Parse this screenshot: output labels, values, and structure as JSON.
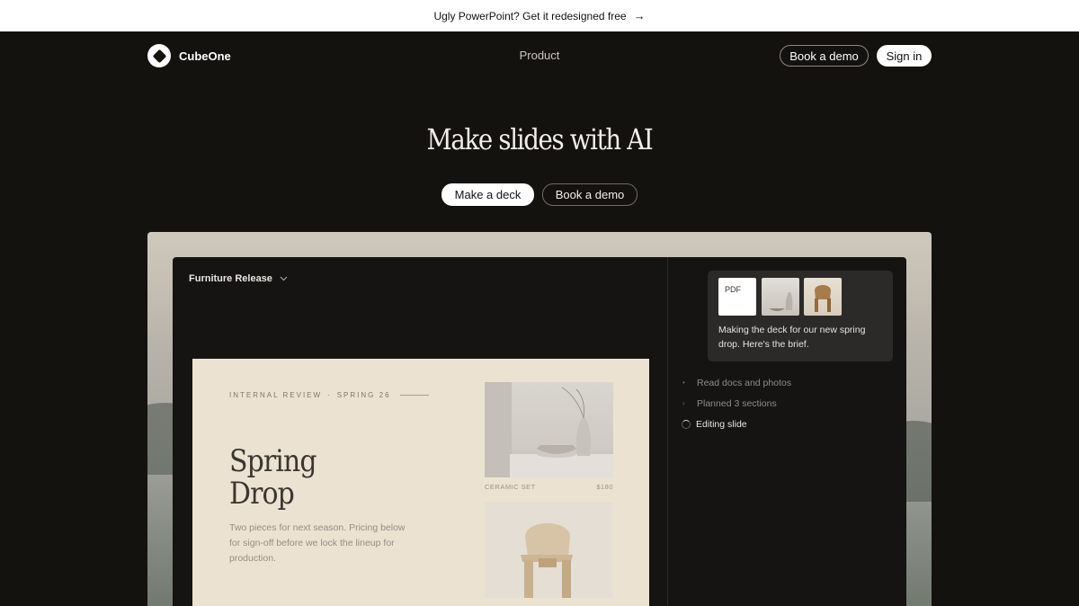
{
  "banner": {
    "text": "Ugly PowerPoint? Get it redesigned free",
    "arrow": "→"
  },
  "nav": {
    "brand": "CubeOne",
    "product": "Product",
    "book_demo": "Book a demo",
    "sign_in": "Sign in"
  },
  "hero": {
    "title": "Make slides with AI",
    "make_deck": "Make a deck",
    "book_demo": "Book a demo"
  },
  "app": {
    "deck_name": "Furniture Release",
    "slide": {
      "eyebrow_left": "INTERNAL REVIEW",
      "eyebrow_sep": "·",
      "eyebrow_right": "SPRING 26",
      "title_line1": "Spring",
      "title_line2": "Drop",
      "body": "Two pieces for next season. Pricing below for sign-off before we lock the lineup for production.",
      "product1_name": "CERAMIC SET",
      "product1_price": "$180"
    },
    "chat": {
      "attachment_pdf": "PDF",
      "message": "Making the deck for our new spring drop. Here's the brief.",
      "steps": [
        {
          "label": "Read docs and photos",
          "bullet": "•"
        },
        {
          "label": "Planned 3 sections",
          "bullet": "›"
        },
        {
          "label": "Editing slide"
        }
      ]
    }
  },
  "icons": {
    "logo": "cube-icon",
    "deck_dropdown": "chevron-down-icon",
    "step_done": "bullet-icon",
    "step_progress": "spinner-icon"
  },
  "colors": {
    "background": "#14120f",
    "slide_bg": "#ebe2d1",
    "panel": "#151412"
  }
}
